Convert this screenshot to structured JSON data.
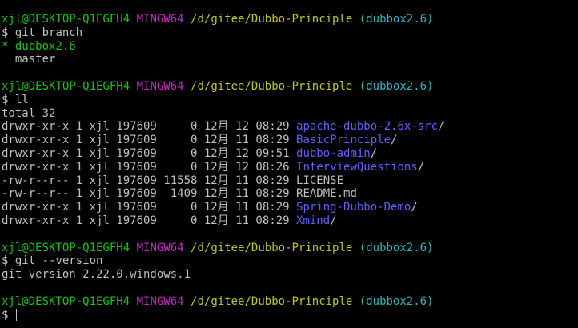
{
  "terminal": {
    "prompt": {
      "user_host": "xjl@DESKTOP-Q1EGFH4",
      "env": "MINGW64",
      "path": "/d/gitee/Dubbo-Principle",
      "branch": "(dubbox2.6)",
      "symbol": "$"
    },
    "blocks": [
      {
        "command": "git branch",
        "output_branches": [
          {
            "marker": "*",
            "name": "dubbox2.6"
          },
          {
            "marker": " ",
            "name": "master"
          }
        ]
      },
      {
        "command": "ll",
        "total": "total 32",
        "files": [
          {
            "perm": "drwxr-xr-x",
            "links": "1",
            "owner": "xjl",
            "group": "197609",
            "size": "0",
            "month": "12月",
            "day": "12",
            "time": "08:29",
            "name": "apache-dubbo-2.6x-src",
            "is_dir": true
          },
          {
            "perm": "drwxr-xr-x",
            "links": "1",
            "owner": "xjl",
            "group": "197609",
            "size": "0",
            "month": "12月",
            "day": "11",
            "time": "08:29",
            "name": "BasicPrinciple",
            "is_dir": true
          },
          {
            "perm": "drwxr-xr-x",
            "links": "1",
            "owner": "xjl",
            "group": "197609",
            "size": "0",
            "month": "12月",
            "day": "12",
            "time": "09:51",
            "name": "dubbo-admin",
            "is_dir": true
          },
          {
            "perm": "drwxr-xr-x",
            "links": "1",
            "owner": "xjl",
            "group": "197609",
            "size": "0",
            "month": "12月",
            "day": "12",
            "time": "08:26",
            "name": "InterviewQuestions",
            "is_dir": true
          },
          {
            "perm": "-rw-r--r--",
            "links": "1",
            "owner": "xjl",
            "group": "197609",
            "size": "11558",
            "month": "12月",
            "day": "11",
            "time": "08:29",
            "name": "LICENSE",
            "is_dir": false
          },
          {
            "perm": "-rw-r--r--",
            "links": "1",
            "owner": "xjl",
            "group": "197609",
            "size": "1409",
            "month": "12月",
            "day": "11",
            "time": "08:29",
            "name": "README.md",
            "is_dir": false
          },
          {
            "perm": "drwxr-xr-x",
            "links": "1",
            "owner": "xjl",
            "group": "197609",
            "size": "0",
            "month": "12月",
            "day": "11",
            "time": "08:29",
            "name": "Spring-Dubbo-Demo",
            "is_dir": true
          },
          {
            "perm": "drwxr-xr-x",
            "links": "1",
            "owner": "xjl",
            "group": "197609",
            "size": "0",
            "month": "12月",
            "day": "11",
            "time": "08:29",
            "name": "Xmind",
            "is_dir": true
          }
        ]
      },
      {
        "command": "git --version",
        "output": "git version 2.22.0.windows.1"
      }
    ],
    "colors": {
      "background": "#000000",
      "text": "#c0c0c0",
      "user_host": "#13c613",
      "env": "#c42ac4",
      "path": "#c4c420",
      "branch": "#2ab6c4",
      "directory": "#6060ff"
    }
  }
}
